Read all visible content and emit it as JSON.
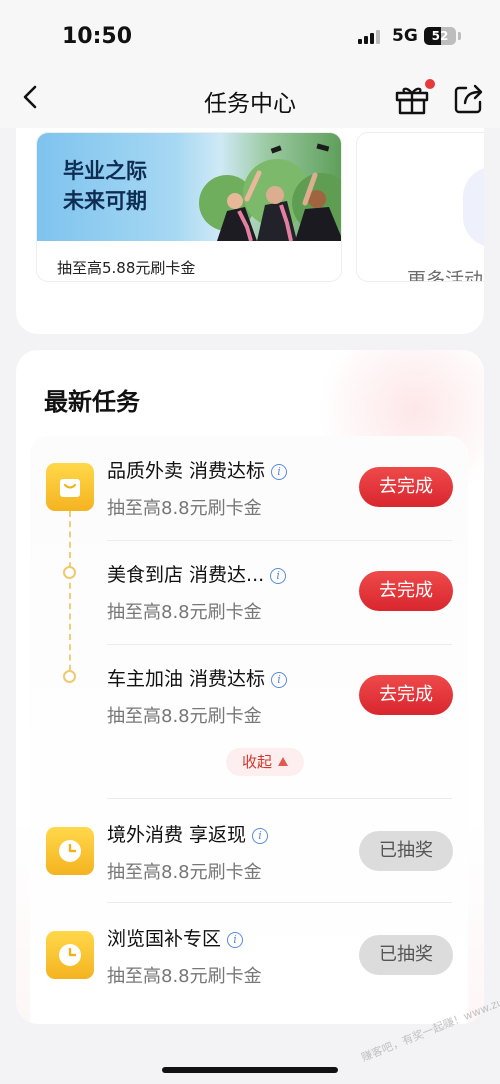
{
  "status_bar": {
    "time": "10:50",
    "network": "5G",
    "battery": "52"
  },
  "nav": {
    "title": "任务中心"
  },
  "banner": {
    "promo_line1": "毕业之际",
    "promo_line2": "未来可期",
    "promo_subtitle": "抽至高5.88元刷卡金",
    "more_label": "更多活动"
  },
  "tasks": {
    "heading": "最新任务",
    "collapse_label": "收起",
    "items": [
      {
        "name": "品质外卖 消费达标",
        "desc": "抽至高8.8元刷卡金",
        "action": "去完成"
      },
      {
        "name": "美食到店 消费达...",
        "desc": "抽至高8.8元刷卡金",
        "action": "去完成"
      },
      {
        "name": "车主加油 消费达标",
        "desc": "抽至高8.8元刷卡金",
        "action": "去完成"
      },
      {
        "name": "境外消费 享返现",
        "desc": "抽至高8.8元刷卡金",
        "action": "已抽奖"
      },
      {
        "name": "浏览国补专区",
        "desc": "抽至高8.8元刷卡金",
        "action": "已抽奖"
      }
    ]
  },
  "watermark": "赚客吧，有奖一起赚！www.zuanke8.com",
  "colors": {
    "primary_red": "#de2f36",
    "icon_yellow": "#f6c230",
    "done_gray": "#dcdcdc"
  }
}
